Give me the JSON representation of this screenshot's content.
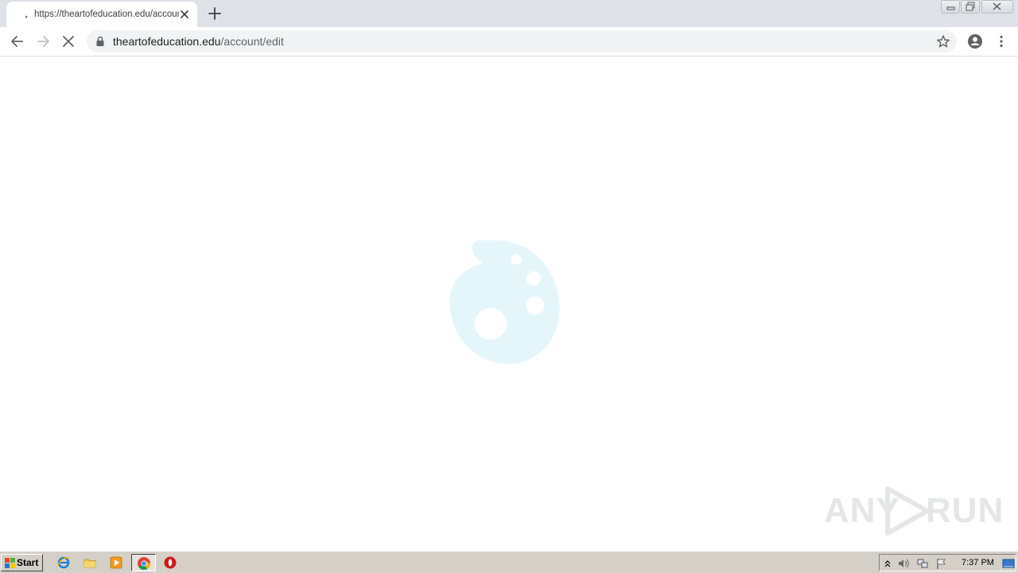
{
  "tab": {
    "title": "https://theartofeducation.edu/account/edit",
    "close_icon": "close-icon",
    "loading_icon": "spinner-icon"
  },
  "newtab_icon": "plus-icon",
  "window_controls": [
    "minimize-icon",
    "maximize-icon",
    "close-icon"
  ],
  "toolbar": {
    "back_icon": "arrow-left-icon",
    "forward_icon": "arrow-right-icon",
    "stop_icon": "close-icon",
    "url_host": "theartofeducation.edu",
    "url_path": "/account/edit",
    "lock_icon": "lock-icon",
    "bookmark_icon": "star-icon",
    "profile_icon": "account-circle-icon",
    "menu_icon": "more-vertical-icon"
  },
  "page": {
    "loading_graphic": "palette-icon",
    "loading_color": "#e5f6fb"
  },
  "watermark": {
    "left": "ANY",
    "right": "RUN"
  },
  "taskbar": {
    "start_label": "Start",
    "quick_launch": [
      "ie-icon",
      "folder-icon",
      "media-player-icon",
      "chrome-icon",
      "opera-icon"
    ],
    "tray_icons": [
      "chevron-up-icon",
      "speaker-icon",
      "network-icon",
      "flag-icon"
    ],
    "clock": "7:37 PM",
    "desktop_icon": "show-desktop-icon"
  },
  "colors": {
    "tabstrip": "#dee1e6",
    "omnibox": "#f1f3f4",
    "taskbar": "#d4d0c8",
    "palette": "#e5f6fb"
  }
}
